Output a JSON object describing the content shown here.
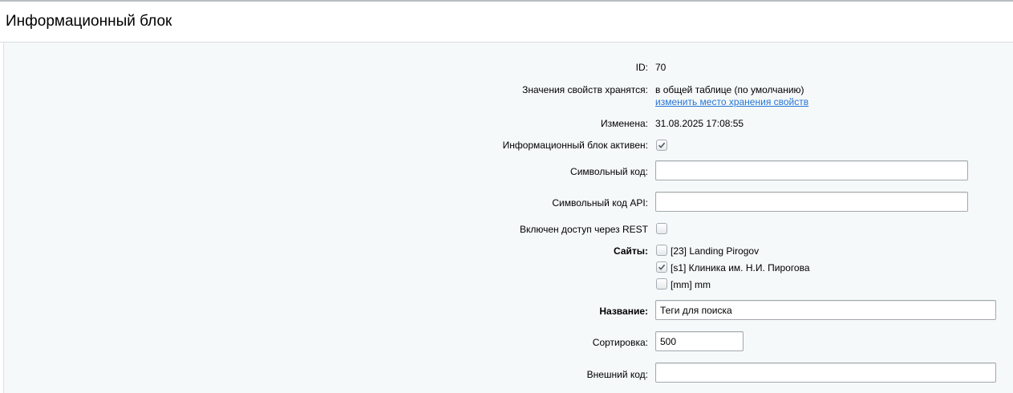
{
  "page": {
    "title": "Информационный блок"
  },
  "fields": {
    "id": {
      "label": "ID:",
      "value": "70"
    },
    "storage": {
      "label": "Значения свойств хранятся:",
      "value": "в общей таблице (по умолчанию)",
      "link": "изменить место хранения свойств"
    },
    "modified": {
      "label": "Изменена:",
      "value": "31.08.2025 17:08:55"
    },
    "active": {
      "label": "Информационный блок активен:",
      "checked": true
    },
    "code": {
      "label": "Символьный код:",
      "value": ""
    },
    "api_code": {
      "label": "Символьный код API:",
      "value": ""
    },
    "rest": {
      "label": "Включен доступ через REST",
      "checked": false
    },
    "sites": {
      "label": "Сайты:",
      "items": [
        {
          "label": "[23] Landing Pirogov",
          "checked": false
        },
        {
          "label": "[s1] Клиника им. Н.И. Пирогова",
          "checked": true
        },
        {
          "label": "[mm] mm",
          "checked": false
        }
      ]
    },
    "name": {
      "label": "Название:",
      "value": "Теги для поиска"
    },
    "sort": {
      "label": "Сортировка:",
      "value": "500"
    },
    "external_code": {
      "label": "Внешний код:",
      "value": ""
    }
  }
}
